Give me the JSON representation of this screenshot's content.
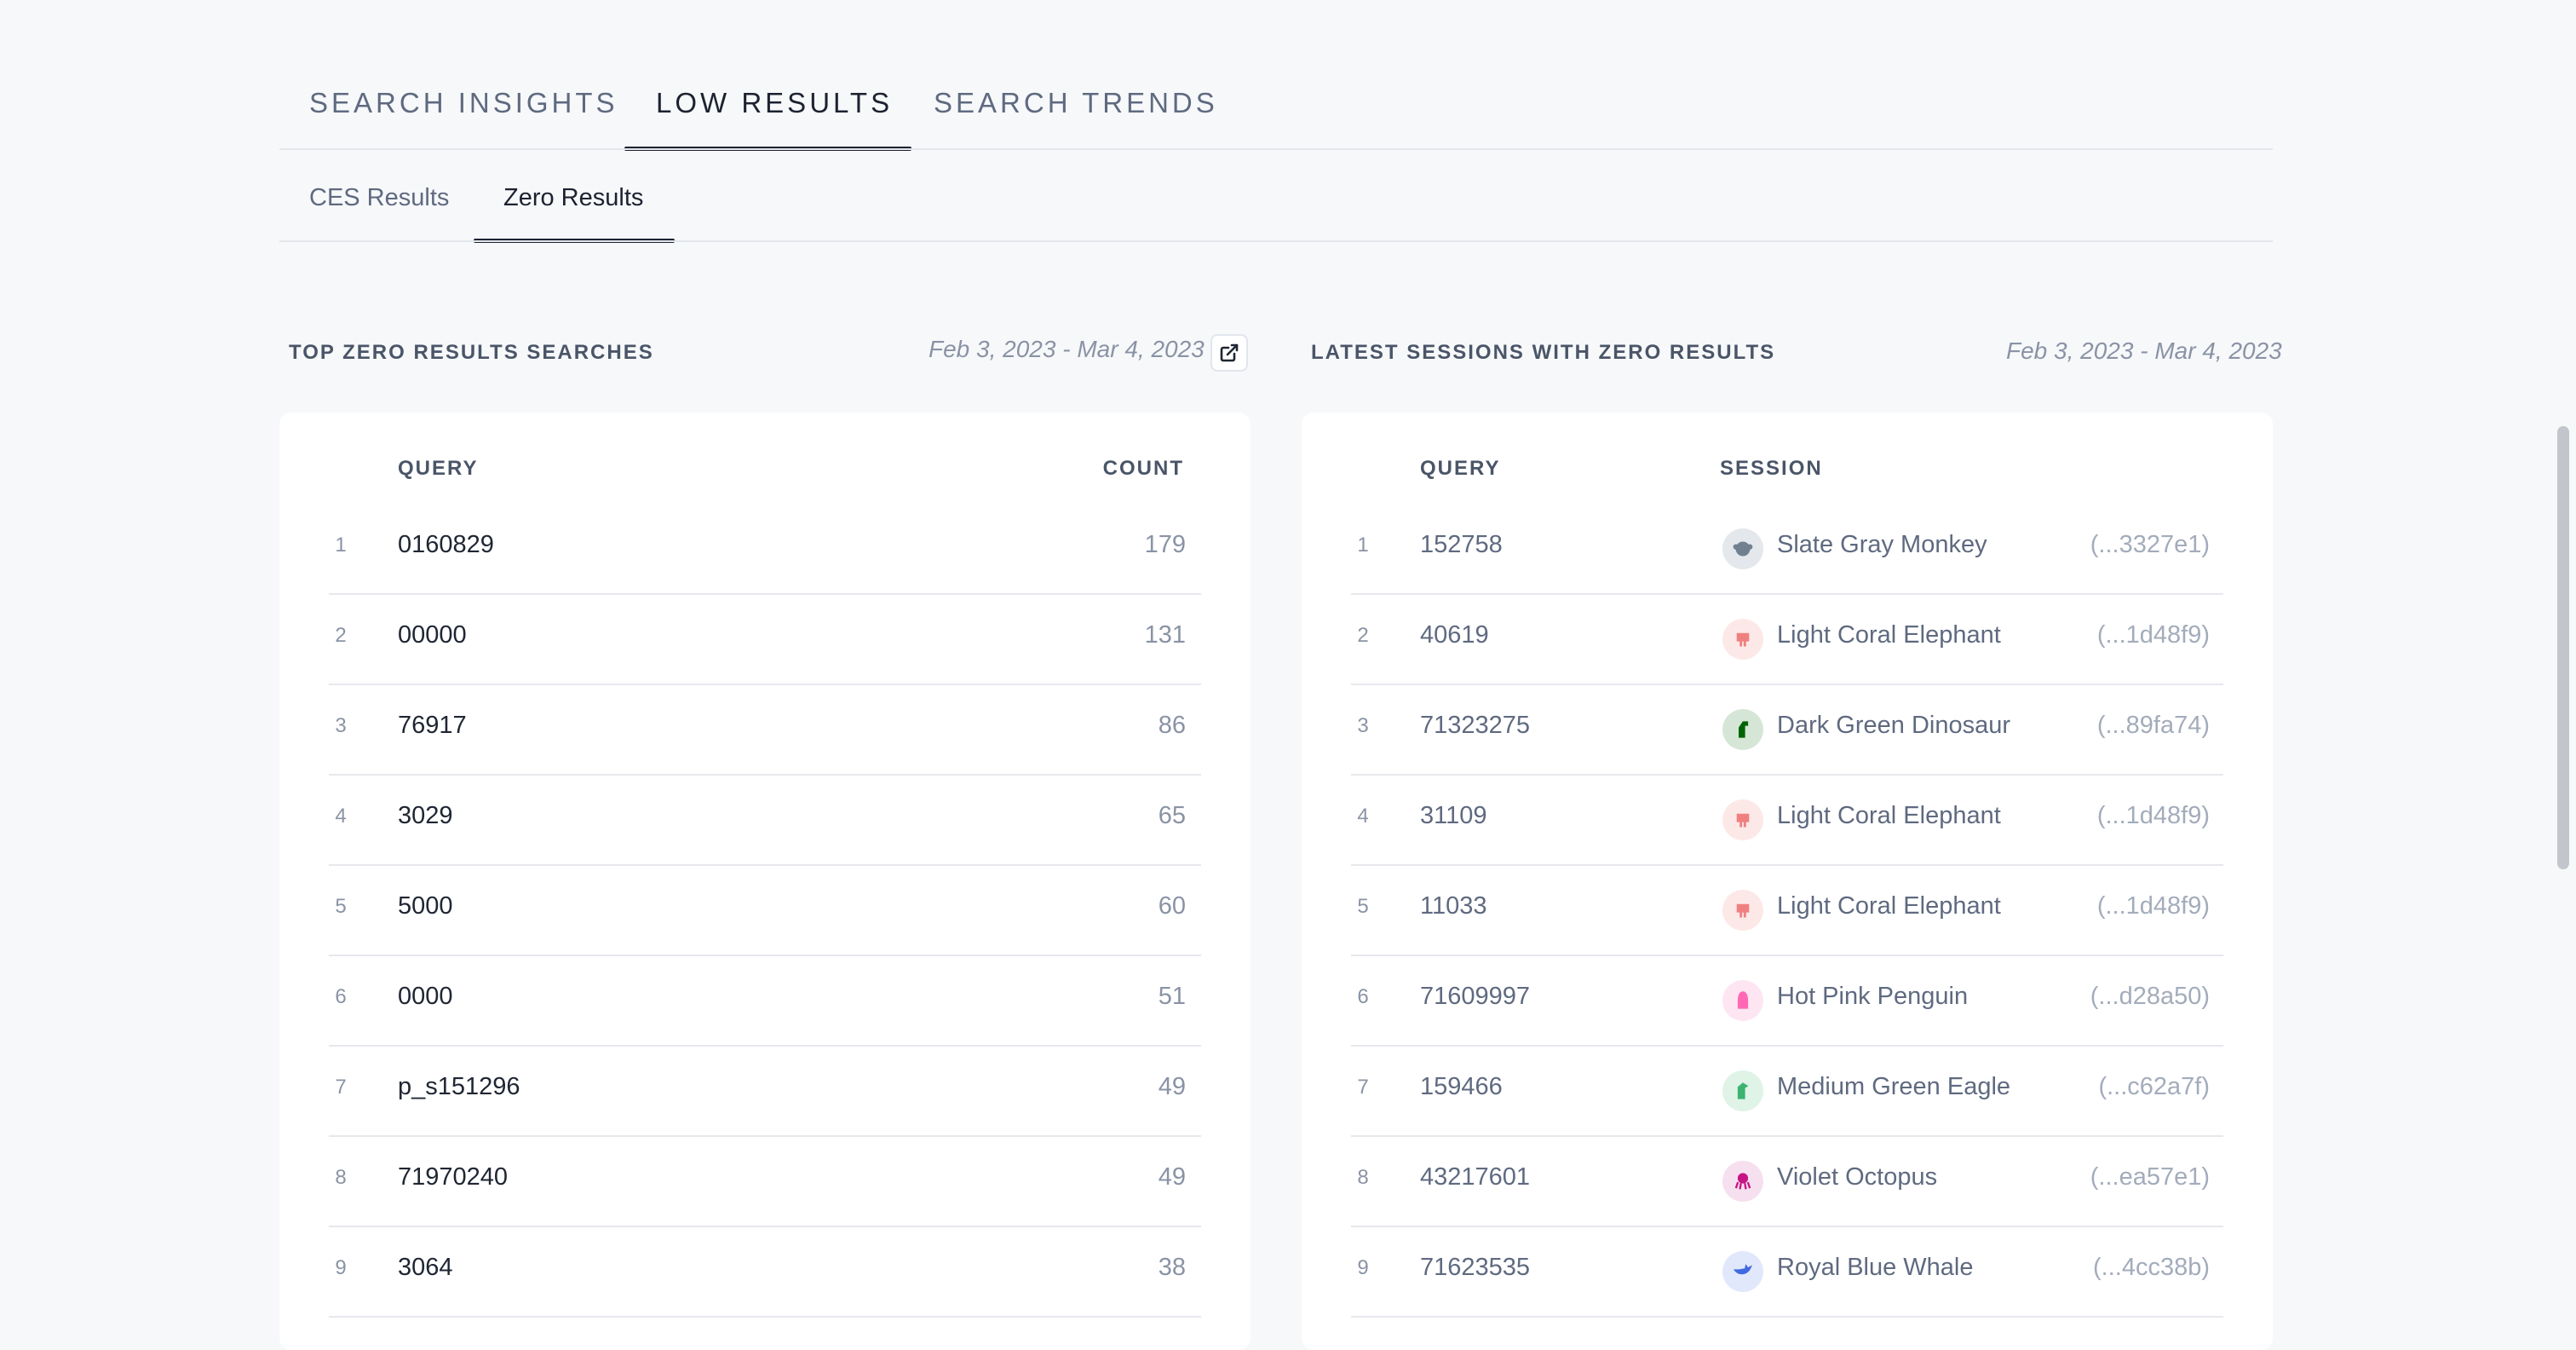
{
  "tabs": {
    "main": [
      "SEARCH INSIGHTS",
      "LOW RESULTS",
      "SEARCH TRENDS"
    ],
    "sub": [
      "CES Results",
      "Zero Results"
    ]
  },
  "left_panel": {
    "title": "TOP ZERO RESULTS SEARCHES",
    "date_range": "Feb 3, 2023 - Mar 4, 2023",
    "col_query": "QUERY",
    "col_count": "COUNT",
    "rows": [
      {
        "rank": "1",
        "query": "0160829",
        "count": "179"
      },
      {
        "rank": "2",
        "query": "00000",
        "count": "131"
      },
      {
        "rank": "3",
        "query": "76917",
        "count": "86"
      },
      {
        "rank": "4",
        "query": "3029",
        "count": "65"
      },
      {
        "rank": "5",
        "query": "5000",
        "count": "60"
      },
      {
        "rank": "6",
        "query": "0000",
        "count": "51"
      },
      {
        "rank": "7",
        "query": "p_s151296",
        "count": "49"
      },
      {
        "rank": "8",
        "query": "71970240",
        "count": "49"
      },
      {
        "rank": "9",
        "query": "3064",
        "count": "38"
      }
    ]
  },
  "right_panel": {
    "title": "LATEST SESSIONS WITH ZERO RESULTS",
    "date_range": "Feb 3, 2023 - Mar 4, 2023",
    "col_query": "QUERY",
    "col_session": "SESSION",
    "rows": [
      {
        "rank": "1",
        "query": "152758",
        "session": "Slate Gray Monkey",
        "id": "(...3327e1)",
        "icon": "monkey-icon",
        "color": "#708090",
        "bg": "#e4e7eb"
      },
      {
        "rank": "2",
        "query": "40619",
        "session": "Light Coral Elephant",
        "id": "(...1d48f9)",
        "icon": "elephant-icon",
        "color": "#f08080",
        "bg": "#fde8e8"
      },
      {
        "rank": "3",
        "query": "71323275",
        "session": "Dark Green Dinosaur",
        "id": "(...89fa74)",
        "icon": "dinosaur-icon",
        "color": "#006400",
        "bg": "#d6e6d6"
      },
      {
        "rank": "4",
        "query": "31109",
        "session": "Light Coral Elephant",
        "id": "(...1d48f9)",
        "icon": "elephant-icon",
        "color": "#f08080",
        "bg": "#fde8e8"
      },
      {
        "rank": "5",
        "query": "11033",
        "session": "Light Coral Elephant",
        "id": "(...1d48f9)",
        "icon": "elephant-icon",
        "color": "#f08080",
        "bg": "#fde8e8"
      },
      {
        "rank": "6",
        "query": "71609997",
        "session": "Hot Pink Penguin",
        "id": "(...d28a50)",
        "icon": "penguin-icon",
        "color": "#ff69b4",
        "bg": "#fde6f2"
      },
      {
        "rank": "7",
        "query": "159466",
        "session": "Medium Green Eagle",
        "id": "(...c62a7f)",
        "icon": "eagle-icon",
        "color": "#3cb371",
        "bg": "#dff3e7"
      },
      {
        "rank": "8",
        "query": "43217601",
        "session": "Violet Octopus",
        "id": "(...ea57e1)",
        "icon": "octopus-icon",
        "color": "#c71585",
        "bg": "#f6e0ef"
      },
      {
        "rank": "9",
        "query": "71623535",
        "session": "Royal Blue Whale",
        "id": "(...4cc38b)",
        "icon": "whale-icon",
        "color": "#4169e1",
        "bg": "#e2e8fb"
      }
    ]
  }
}
